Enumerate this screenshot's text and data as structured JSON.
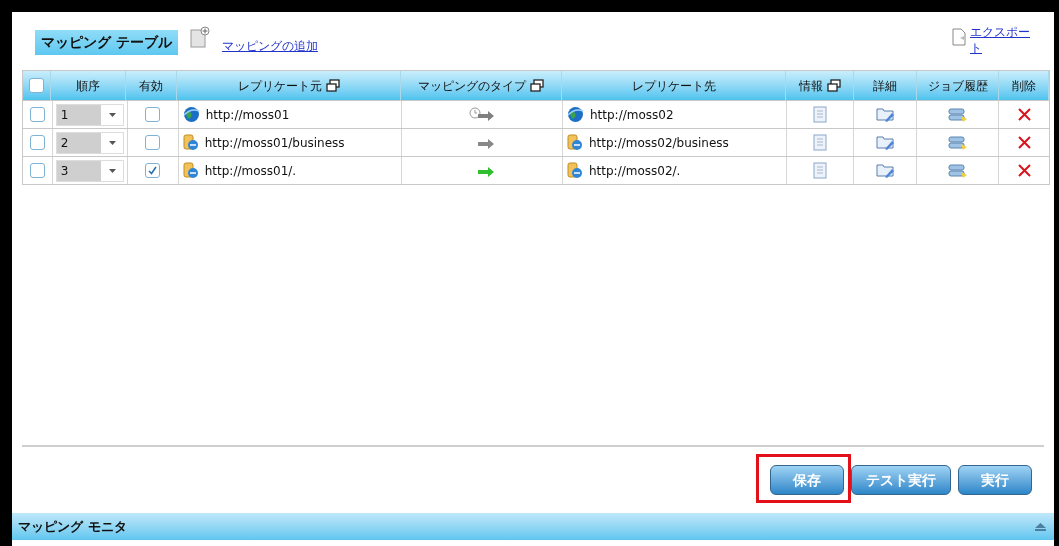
{
  "header": {
    "title": "マッピング テーブル",
    "add_link": "マッピングの追加",
    "export_link": "エクスポート"
  },
  "table": {
    "columns": [
      {
        "label": "順序",
        "popout": false
      },
      {
        "label": "有効",
        "popout": false
      },
      {
        "label": "レプリケート元",
        "popout": true
      },
      {
        "label": "マッピングのタイプ",
        "popout": true
      },
      {
        "label": "レプリケート先",
        "popout": false
      },
      {
        "label": "情報",
        "popout": true
      },
      {
        "label": "詳細",
        "popout": false
      },
      {
        "label": "ジョブ履歴",
        "popout": false
      },
      {
        "label": "削除",
        "popout": false
      }
    ],
    "select_all_checked": false,
    "rows": [
      {
        "checked": false,
        "order": "1",
        "enabled": false,
        "source": {
          "kind": "globe",
          "url": "http://moss01"
        },
        "mapping": {
          "kind": "scheduled"
        },
        "target": {
          "kind": "globe",
          "url": "http://moss02"
        }
      },
      {
        "checked": false,
        "order": "2",
        "enabled": false,
        "source": {
          "kind": "site",
          "url": "http://moss01/business"
        },
        "mapping": {
          "kind": "idle"
        },
        "target": {
          "kind": "site",
          "url": "http://moss02/business"
        }
      },
      {
        "checked": false,
        "order": "3",
        "enabled": true,
        "source": {
          "kind": "site",
          "url": "http://moss01/."
        },
        "mapping": {
          "kind": "active"
        },
        "target": {
          "kind": "site",
          "url": "http://moss02/."
        }
      }
    ]
  },
  "buttons": [
    {
      "label": "保存",
      "highlighted": true
    },
    {
      "label": "テスト実行",
      "highlighted": false
    },
    {
      "label": "実行",
      "highlighted": false
    }
  ],
  "monitor": {
    "title": "マッピング モニタ"
  }
}
